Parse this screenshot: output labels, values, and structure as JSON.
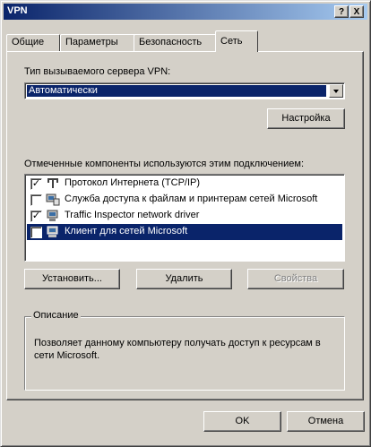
{
  "window": {
    "title": "VPN",
    "help_glyph": "?",
    "close_glyph": "X"
  },
  "tabs": [
    {
      "label": "Общие"
    },
    {
      "label": "Параметры"
    },
    {
      "label": "Безопасность"
    },
    {
      "label": "Сеть"
    }
  ],
  "server_type": {
    "label": "Тип вызываемого сервера VPN:",
    "selected_value": "Автоматически",
    "settings_button": "Настройка"
  },
  "components": {
    "label": "Отмеченные компоненты используются этим подключением:",
    "items": [
      {
        "label": "Протокол Интернета (TCP/IP)",
        "checked": true,
        "icon": "network-protocol-icon",
        "check_glyph": "✓"
      },
      {
        "label": "Служба доступа к файлам и принтерам сетей Microsoft",
        "checked": false,
        "icon": "network-service-icon",
        "check_glyph": ""
      },
      {
        "label": "Traffic Inspector network driver",
        "checked": true,
        "icon": "network-driver-icon",
        "check_glyph": "✓"
      },
      {
        "label": "Клиент для сетей Microsoft",
        "checked": false,
        "icon": "network-client-icon",
        "check_glyph": "",
        "selected": true
      }
    ]
  },
  "buttons": {
    "install": "Установить...",
    "remove": "Удалить",
    "properties": "Свойства"
  },
  "description": {
    "legend": "Описание",
    "text": "Позволяет данному компьютеру получать доступ к ресурсам в сети Microsoft."
  },
  "footer": {
    "ok": "OK",
    "cancel": "Отмена"
  },
  "colors": {
    "face": "#d4d0c8",
    "selection": "#0a246a",
    "title_start": "#0a246a",
    "title_end": "#a6caf0"
  }
}
